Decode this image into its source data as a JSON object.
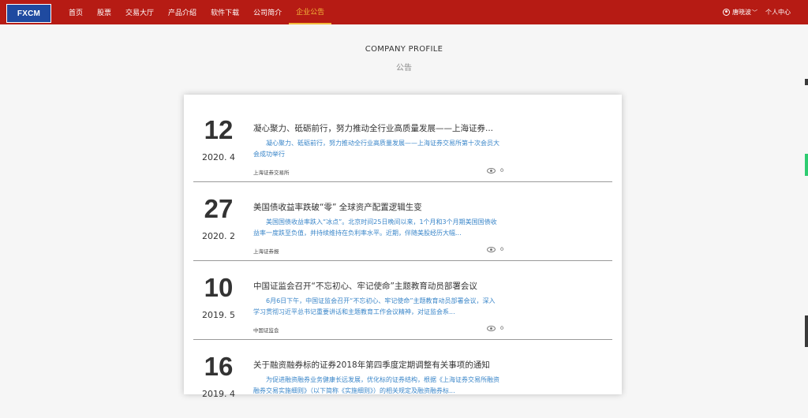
{
  "nav": {
    "logo": "FXCM",
    "items": [
      "首页",
      "股票",
      "交易大厅",
      "产品介绍",
      "软件下载",
      "公司简介",
      "企业公告"
    ],
    "active_index": 6,
    "user": "唐晓波",
    "profile": "个人中心"
  },
  "page": {
    "heading_en": "COMPANY PROFILE",
    "heading_cn": "公告"
  },
  "articles": [
    {
      "day": "12",
      "year_month": "2020. 4",
      "title": "凝心聚力、砥砺前行，努力推动全行业高质量发展——上海证券...",
      "summary": "凝心聚力、砥砺前行，努力推动全行业高质量发展——上海证券交易所第十次会员大会成功举行",
      "source": "上海证券交易所",
      "views": "0"
    },
    {
      "day": "27",
      "year_month": "2020. 2",
      "title": "美国债收益率跌破“零” 全球资产配置逻辑生变",
      "summary": "美国国债收益率跌入“冰点”。北京时间25日晚间以来，1个月和3个月期美国国债收益率一度跌至负值，并持续维持在负利率水平。近期，伴随美股经历大幅...",
      "source": "上海证券报",
      "views": "0"
    },
    {
      "day": "10",
      "year_month": "2019. 5",
      "title": "中国证监会召开“不忘初心、牢记使命”主题教育动员部署会议",
      "summary": "6月6日下午，中国证监会召开“不忘初心、牢记使命”主题教育动员部署会议，深入学习贯彻习近平总书记重要讲话和主题教育工作会议精神，对证监会系...",
      "source": "中国证监会",
      "views": "0"
    },
    {
      "day": "16",
      "year_month": "2019. 4",
      "title": "关于融资融券标的证券2018年第四季度定期调整有关事项的通知",
      "summary": "为促进融资融券业务健康长远发展，优化标的证券结构，根据《上海证券交易所融资融券交易实施细则》（以下简称《实施细则》）的相关规定及融资融券标...",
      "source": "",
      "views": ""
    }
  ]
}
